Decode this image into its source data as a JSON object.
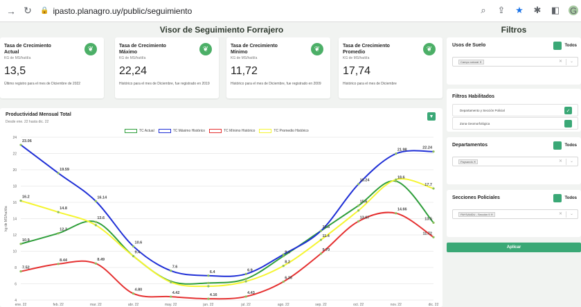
{
  "browser": {
    "url": "ipasto.planagro.uy/public/seguimiento",
    "back_icon": "arrow-left-icon",
    "reload_icon": "reload-icon",
    "avatar_letter": "G"
  },
  "page": {
    "title": "Visor de Seguimiento Forrajero",
    "filters_title": "Filtros"
  },
  "cards": [
    {
      "title": "Tasa de Crecimiento Actual",
      "unit": "KG de MS/ha/día",
      "value": "13,5",
      "desc": "Último registro para el mes de Diciembre de 2022"
    },
    {
      "title": "Tasa de Crecimiento Máximo",
      "unit": "KG de MS/ha/día",
      "value": "22,24",
      "desc": "Histórico para el mes de Diciembre, fue registrado en 2019"
    },
    {
      "title": "Tasa de Crecimiento Mínimo",
      "unit": "KG de MS/ha/día",
      "value": "11,72",
      "desc": "Histórico para el mes de Diciembre, fue registrado en 2009"
    },
    {
      "title": "Tasa de Crecimiento Promedio",
      "unit": "KG de MS/ha/día",
      "value": "17,74",
      "desc": "Histórico para el mes de Diciembre"
    }
  ],
  "chart_card": {
    "title": "Productividad Mensual Total",
    "subtitle": "Desde ene. 22 hasta dic. 22"
  },
  "chart_data": {
    "type": "line",
    "categories": [
      "ene. 22",
      "feb. 22",
      "mar. 22",
      "abr. 22",
      "may. 22",
      "jun. 22",
      "jul. 22",
      "ago. 22",
      "sep. 22",
      "oct. 22",
      "nov. 22",
      "dic. 22"
    ],
    "ylabel": "kg de MS/ha/día",
    "ylim": [
      4,
      24
    ],
    "yticks": [
      4,
      6,
      8,
      10,
      12,
      14,
      16,
      18,
      20,
      22,
      24
    ],
    "grid": true,
    "legend_position": "top",
    "series": [
      {
        "name": "TC Actual",
        "color": "#2e9e3a",
        "values": [
          10.9,
          12.2,
          13.6,
          9.4,
          6.3,
          6.1,
          6.6,
          9.4,
          12.5,
          15.6,
          18.6,
          13.5
        ]
      },
      {
        "name": "TC Máximo Histórico",
        "color": "#1f2fd6",
        "values": [
          23.06,
          19.59,
          16.14,
          10.6,
          7.6,
          7.0,
          7.2,
          9.6,
          12.5,
          18.24,
          21.98,
          22.24
        ]
      },
      {
        "name": "TC Mínimo Histórico",
        "color": "#e53030",
        "values": [
          7.52,
          8.44,
          8.49,
          4.8,
          4.42,
          4.16,
          4.43,
          6.26,
          9.7,
          13.67,
          14.66,
          11.72
        ]
      },
      {
        "name": "TC Promedio Histórico",
        "color": "#f5f531",
        "values": [
          16.2,
          14.8,
          13.2,
          9.4,
          6.2,
          5.7,
          6.3,
          8.2,
          11.4,
          15.0,
          18.8,
          17.7
        ]
      }
    ],
    "labels": [
      {
        "text": "23.06",
        "cat": 0,
        "val": 23.06
      },
      {
        "text": "19.59",
        "cat": 1,
        "val": 19.59
      },
      {
        "text": "16.14",
        "cat": 2,
        "val": 16.14
      },
      {
        "text": "10.6",
        "cat": 3,
        "val": 10.6
      },
      {
        "text": "7.6",
        "cat": 4,
        "val": 7.6
      },
      {
        "text": "6.4",
        "cat": 5,
        "val": 7.0
      },
      {
        "text": "6.9",
        "cat": 6,
        "val": 7.2
      },
      {
        "text": "18.24",
        "cat": 9,
        "val": 18.24
      },
      {
        "text": "21.98",
        "cat": 10,
        "val": 21.98
      },
      {
        "text": "22.24",
        "cat": 11,
        "val": 22.24
      },
      {
        "text": "16.2",
        "cat": 0,
        "val": 16.2
      },
      {
        "text": "14.8",
        "cat": 1,
        "val": 14.8
      },
      {
        "text": "13.6",
        "cat": 2,
        "val": 13.6
      },
      {
        "text": "12.2",
        "cat": 1,
        "val": 12.2
      },
      {
        "text": "10.9",
        "cat": 0,
        "val": 10.9
      },
      {
        "text": "9.4",
        "cat": 3,
        "val": 9.4
      },
      {
        "text": "9.4",
        "cat": 7,
        "val": 9.4
      },
      {
        "text": "8.2",
        "cat": 7,
        "val": 8.2
      },
      {
        "text": "12.5",
        "cat": 8,
        "val": 12.5
      },
      {
        "text": "11.4",
        "cat": 8,
        "val": 11.4
      },
      {
        "text": "15.6",
        "cat": 9,
        "val": 15.6
      },
      {
        "text": "18.6",
        "cat": 10,
        "val": 18.6
      },
      {
        "text": "17.7",
        "cat": 11,
        "val": 17.7
      },
      {
        "text": "13.5",
        "cat": 11,
        "val": 13.5
      },
      {
        "text": "7.52",
        "cat": 0,
        "val": 7.52
      },
      {
        "text": "8.44",
        "cat": 1,
        "val": 8.44
      },
      {
        "text": "8.49",
        "cat": 2,
        "val": 8.49
      },
      {
        "text": "4.80",
        "cat": 3,
        "val": 4.8
      },
      {
        "text": "4.42",
        "cat": 4,
        "val": 4.42
      },
      {
        "text": "4.16",
        "cat": 5,
        "val": 4.16
      },
      {
        "text": "4.43",
        "cat": 6,
        "val": 4.43
      },
      {
        "text": "6.26",
        "cat": 7,
        "val": 6.26
      },
      {
        "text": "9.70",
        "cat": 8,
        "val": 9.7
      },
      {
        "text": "13.67",
        "cat": 9,
        "val": 13.67
      },
      {
        "text": "14.66",
        "cat": 10,
        "val": 14.66
      },
      {
        "text": "11.72",
        "cat": 11,
        "val": 11.72
      }
    ]
  },
  "filters": {
    "usos": {
      "title": "Usos de Suelo",
      "todos": "Todos",
      "chip": "Campo natural"
    },
    "habilitados": {
      "title": "Filtros Habilitados",
      "row1": "Departamento y Sección Policial",
      "row2": "Zona Geomorfológica"
    },
    "departamentos": {
      "title": "Departamentos",
      "todos": "Todos",
      "chip": "Paysandú"
    },
    "secciones": {
      "title": "Secciones Policiales",
      "todos": "Todos",
      "chip": "PAYSANDU - Sección 9"
    },
    "apply_label": "Aplicar"
  }
}
